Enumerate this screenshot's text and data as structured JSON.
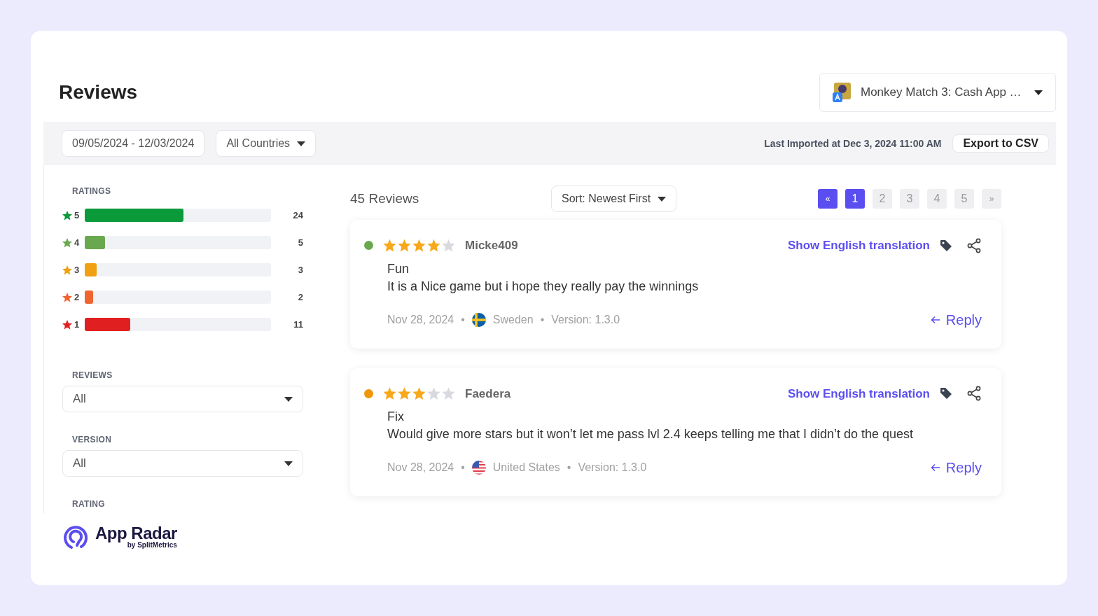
{
  "header": {
    "title": "Reviews",
    "app_selector": {
      "label": "Monkey Match 3: Cash App …"
    }
  },
  "toolbar": {
    "date_range": "09/05/2024 - 12/03/2024",
    "country": "All Countries",
    "last_imported": "Last Imported at Dec 3, 2024 11:00 AM",
    "export_button": "Export to CSV"
  },
  "sidebar": {
    "ratings_title": "RATINGS",
    "ratings": [
      {
        "label": "5",
        "count": "24",
        "level": 0.53,
        "color": "#0a9a3a"
      },
      {
        "label": "4",
        "count": "5",
        "level": 0.11,
        "color": "#6aa84f"
      },
      {
        "label": "3",
        "count": "3",
        "level": 0.065,
        "color": "#f0a010"
      },
      {
        "label": "2",
        "count": "2",
        "level": 0.045,
        "color": "#ee6530"
      },
      {
        "label": "1",
        "count": "11",
        "level": 0.245,
        "color": "#e02020"
      }
    ],
    "filters": [
      {
        "label": "REVIEWS",
        "value": "All"
      },
      {
        "label": "VERSION",
        "value": "All"
      },
      {
        "label": "RATING"
      }
    ]
  },
  "reviews_panel": {
    "count": "45 Reviews",
    "sort": "Sort: Newest First",
    "pagination": [
      {
        "label": "«",
        "kind": "nav",
        "highlighted": true
      },
      {
        "label": "1",
        "kind": "page",
        "highlighted": true
      },
      {
        "label": "2",
        "kind": "page",
        "highlighted": false
      },
      {
        "label": "3",
        "kind": "page",
        "highlighted": false
      },
      {
        "label": "4",
        "kind": "page",
        "highlighted": false
      },
      {
        "label": "5",
        "kind": "page",
        "highlighted": false
      },
      {
        "label": "»",
        "kind": "nav",
        "highlighted": false
      }
    ],
    "reviews": [
      {
        "color": "#6aa84f",
        "stars": 4,
        "author": "Micke409",
        "translate_link": "Show English translation",
        "title": "Fun",
        "body": "It is a Nice game but i hope they really pay the winnings",
        "date": "Nov 28, 2024",
        "separator": "•",
        "kind": "se",
        "country": "Sweden",
        "version": "Version: 1.3.0",
        "reply": "Reply"
      },
      {
        "color": "#f0960a",
        "stars": 3,
        "author": "Faedera",
        "translate_link": "Show English translation",
        "title": "Fix",
        "body": "Would give more stars but it won’t let me pass lvl 2.4 keeps telling me that I didn’t do the quest",
        "date": "Nov 28, 2024",
        "separator": "•",
        "kind": "us",
        "country": "United States",
        "version": "Version: 1.3.0",
        "reply": "Reply"
      }
    ]
  },
  "footer": {
    "brand": "App Radar",
    "byline": "by SplitMetrics"
  }
}
